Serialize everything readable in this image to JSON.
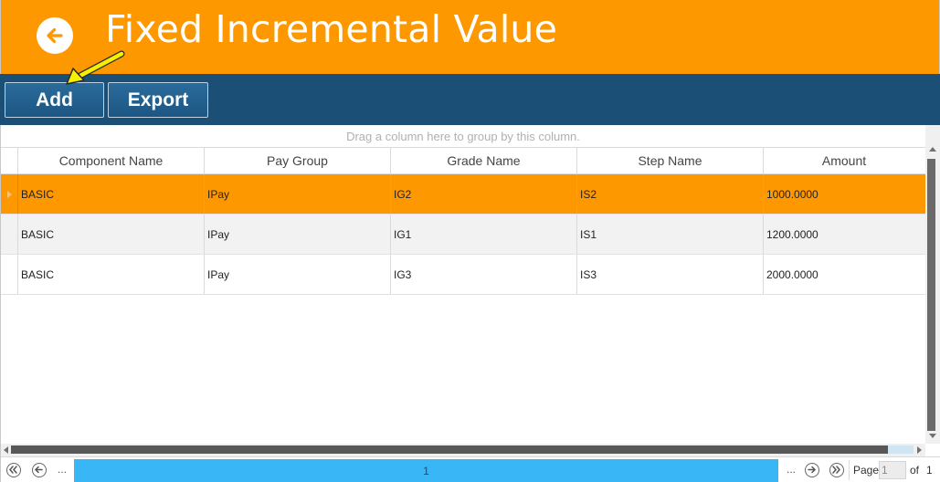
{
  "header": {
    "title": "Fixed Incremental Value",
    "back_icon": "arrow-left-circle-icon",
    "background": "#fe9800"
  },
  "toolbar": {
    "background": "#1b4f76",
    "add_label": "Add",
    "export_label": "Export"
  },
  "grid": {
    "group_hint": "Drag a column here to group by this column.",
    "columns": [
      "Component Name",
      "Pay Group",
      "Grade Name",
      "Step Name",
      "Amount"
    ],
    "rows": [
      [
        "BASIC",
        "IPay",
        "IG2",
        "IS2",
        "1000.0000"
      ],
      [
        "BASIC",
        "IPay",
        "IG1",
        "IS1",
        "1200.0000"
      ],
      [
        "BASIC",
        "IPay",
        "IG3",
        "IS3",
        "2000.0000"
      ]
    ],
    "selected_row": 0,
    "selected_color": "#fe9800"
  },
  "pager": {
    "ellipsis": "...",
    "current_page_label": "1",
    "page_label": "Page",
    "page_value": "1",
    "of_label": "of",
    "total_pages": "1",
    "bar_color": "#39b6f5"
  }
}
